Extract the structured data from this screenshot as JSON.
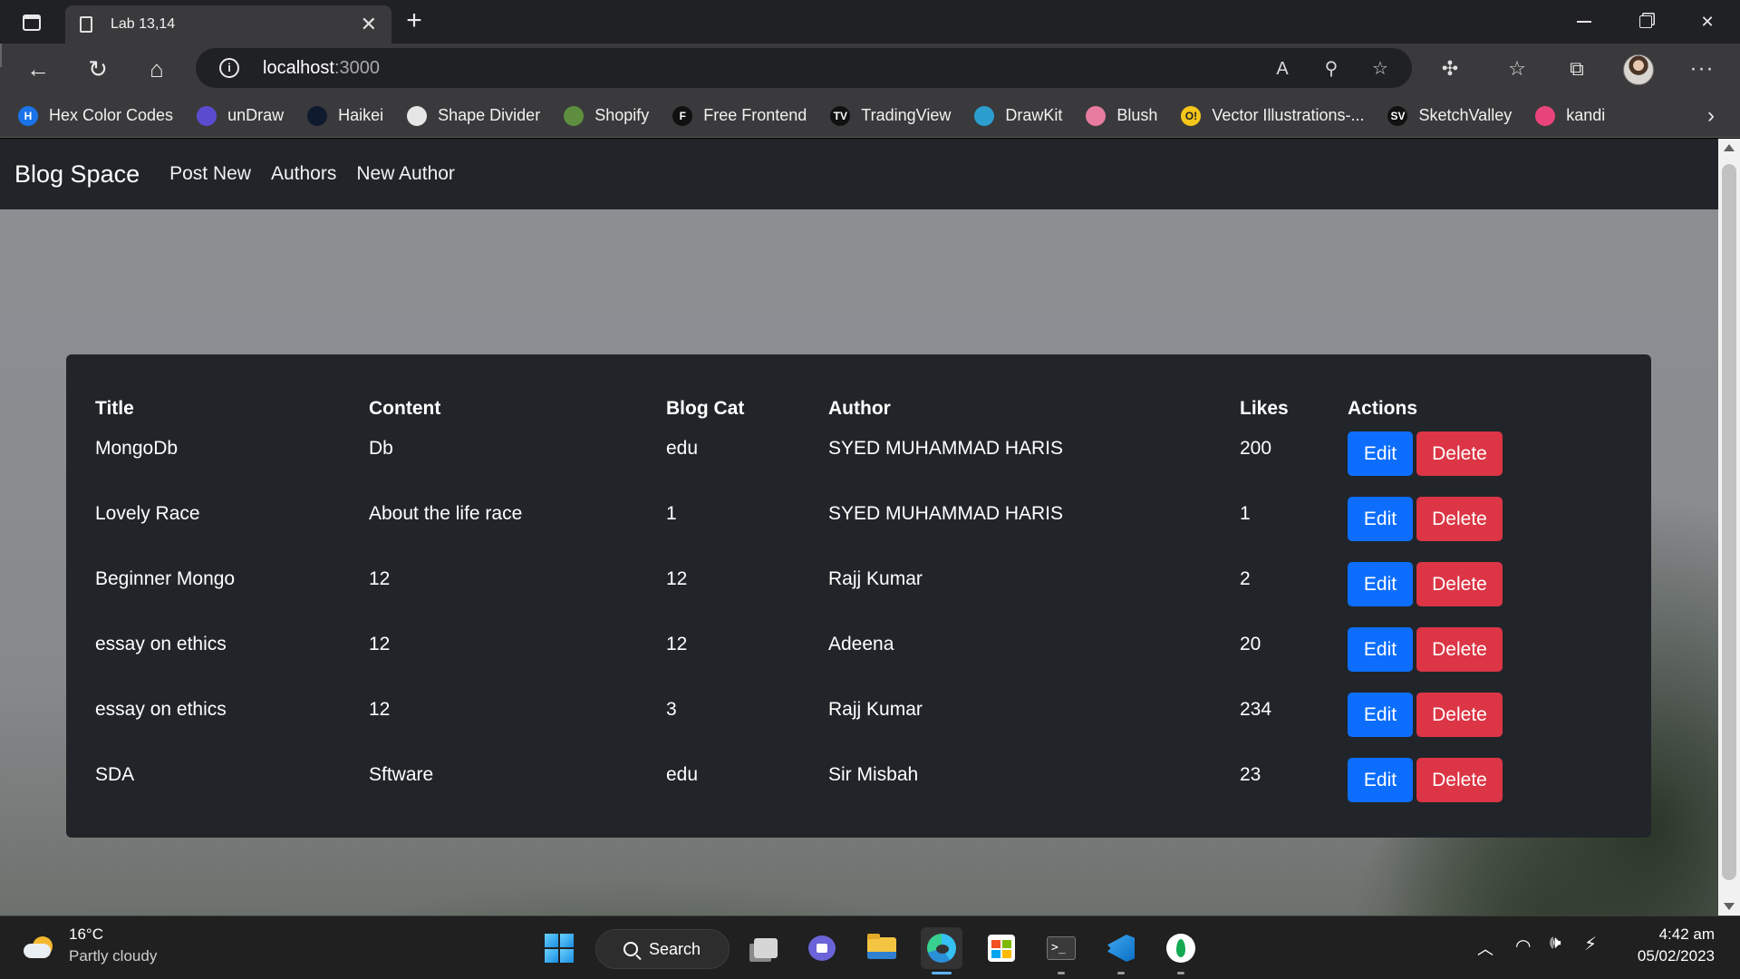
{
  "browser": {
    "tab_title": "Lab 13,14",
    "url_host": "localhost",
    "url_port": ":3000",
    "icons": [
      "tab-actions-icon",
      "document-icon",
      "close-icon",
      "plus-icon",
      "back-icon",
      "refresh-icon",
      "home-icon",
      "info-icon",
      "read-aloud-icon",
      "zoom-icon",
      "add-favorite-icon",
      "extensions-icon",
      "favorites-icon",
      "collections-icon",
      "profile-avatar",
      "more-icon"
    ]
  },
  "bookmarks": [
    {
      "label": "Hex Color Codes",
      "icon": "H",
      "color": "#1a73e8"
    },
    {
      "label": "unDraw",
      "icon": "",
      "color": "#5b4ccf"
    },
    {
      "label": "Haikei",
      "icon": "",
      "color": "#0f1a2e"
    },
    {
      "label": "Shape Divider",
      "icon": "",
      "color": "#e6e6e6"
    },
    {
      "label": "Shopify",
      "icon": "",
      "color": "#5e8e3e"
    },
    {
      "label": "Free Frontend",
      "icon": "F",
      "color": "#111111"
    },
    {
      "label": "TradingView",
      "icon": "TV",
      "color": "#111111"
    },
    {
      "label": "DrawKit",
      "icon": "",
      "color": "#2c9fcf"
    },
    {
      "label": "Blush",
      "icon": "",
      "color": "#e77ca0"
    },
    {
      "label": "Vector Illustrations-...",
      "icon": "O!",
      "color": "#f4c61b"
    },
    {
      "label": "SketchValley",
      "icon": "SV",
      "color": "#111111"
    },
    {
      "label": "kandi",
      "icon": "",
      "color": "#e8437a"
    }
  ],
  "app": {
    "brand": "Blog Space",
    "nav": [
      "Post New",
      "Authors",
      "New Author"
    ]
  },
  "table": {
    "headers": [
      "Title",
      "Content",
      "Blog Cat",
      "Author",
      "Likes",
      "Actions"
    ],
    "rows": [
      {
        "title": "MongoDb",
        "content": "Db",
        "category": "edu",
        "author": "SYED MUHAMMAD HARIS",
        "likes": "200"
      },
      {
        "title": "Lovely Race",
        "content": "About the life race",
        "category": "1",
        "author": "SYED MUHAMMAD HARIS",
        "likes": "1"
      },
      {
        "title": "Beginner Mongo",
        "content": "12",
        "category": "12",
        "author": "Rajj Kumar",
        "likes": "2"
      },
      {
        "title": "essay on ethics",
        "content": "12",
        "category": "12",
        "author": "Adeena",
        "likes": "20"
      },
      {
        "title": "essay on ethics",
        "content": "12",
        "category": "3",
        "author": "Rajj Kumar",
        "likes": "234"
      },
      {
        "title": "SDA",
        "content": "Sftware",
        "category": "edu",
        "author": "Sir Misbah",
        "likes": "23"
      }
    ],
    "edit_label": "Edit",
    "delete_label": "Delete"
  },
  "taskbar": {
    "weather_temp": "16°C",
    "weather_desc": "Partly cloudy",
    "search_label": "Search",
    "time": "4:42 am",
    "date": "05/02/2023"
  },
  "colors": {
    "primary": "#0d6efd",
    "danger": "#dc3545",
    "dark": "#212529"
  }
}
